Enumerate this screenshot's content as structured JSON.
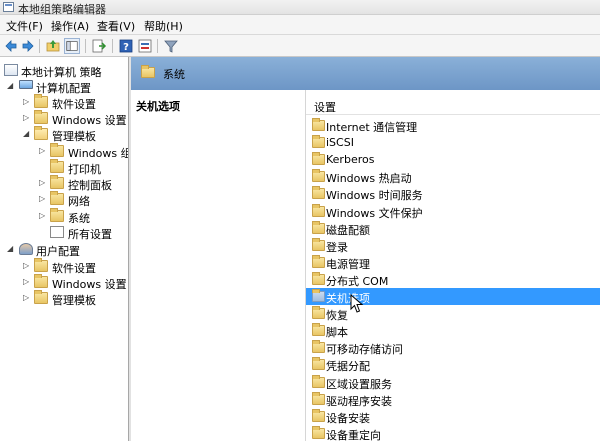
{
  "window": {
    "title": "本地组策略编辑器"
  },
  "menu": [
    "文件(F)",
    "操作(A)",
    "查看(V)",
    "帮助(H)"
  ],
  "toolbar": {
    "buttons": [
      "back-icon",
      "forward-icon",
      "up-folder-icon",
      "show-tree-icon",
      "export-icon",
      "help-icon",
      "properties-icon",
      "filter-icon"
    ]
  },
  "tree": {
    "root": "本地计算机 策略",
    "computer": "计算机配置",
    "computer_children": [
      "软件设置",
      "Windows 设置",
      "管理模板"
    ],
    "admin_children": [
      "Windows 组",
      "打印机",
      "控制面板",
      "网络",
      "系统",
      "所有设置"
    ],
    "user": "用户配置",
    "user_children": [
      "软件设置",
      "Windows 设置",
      "管理模板"
    ]
  },
  "content": {
    "header_title": "系统",
    "description_label": "关机选项",
    "column_header": "设置",
    "items": [
      "Internet 通信管理",
      "iSCSI",
      "Kerberos",
      "Windows 热启动",
      "Windows 时间服务",
      "Windows 文件保护",
      "磁盘配额",
      "登录",
      "电源管理",
      "分布式 COM",
      "关机选项",
      "恢复",
      "脚本",
      "可移动存储访问",
      "凭据分配",
      "区域设置服务",
      "驱动程序安装",
      "设备安装",
      "设备重定向"
    ],
    "selected_item": "关机选项"
  },
  "colors": {
    "header_band": "#7aa3d0",
    "selection": "#3399ff",
    "folder": "#e8c564"
  }
}
